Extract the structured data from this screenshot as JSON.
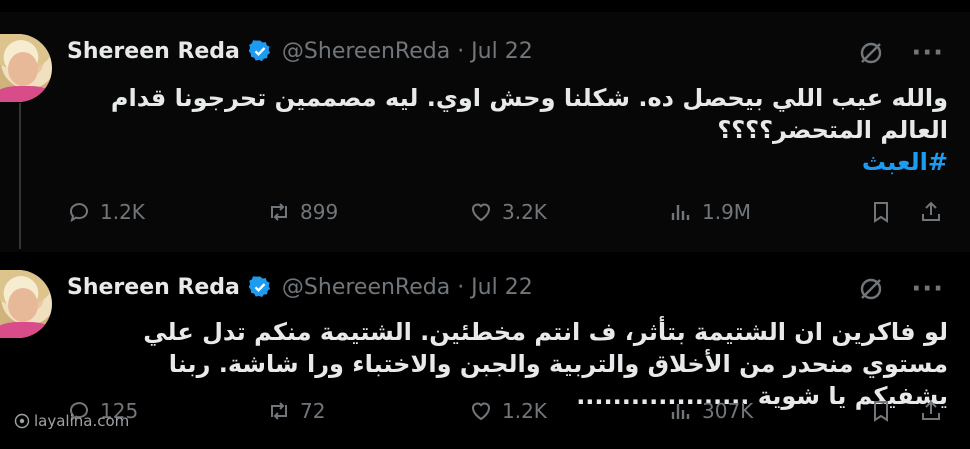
{
  "tweets": [
    {
      "name": "Shereen Reda",
      "handle": "@ShereenReda · Jul 22",
      "text": "والله عيب اللي بيحصل ده. شكلنا وحش اوي. ليه مصممين تحرجونا قدام العالم المتحضر؟؟؟؟",
      "hashtag": "#العبث",
      "replies": "1.2K",
      "reposts": "899",
      "likes": "3.2K",
      "views": "1.9M"
    },
    {
      "name": "Shereen Reda",
      "handle": "@ShereenReda · Jul 22",
      "text": "لو فاكرين ان الشتيمة بتأثر، ف انتم مخطئين. الشتيمة منكم تدل علي مستوي منحدر من الأخلاق والتربية والجبن والاختباء ورا شاشة. ربنا يشفيكم يا شوية ...................",
      "replies": "125",
      "reposts": "72",
      "likes": "1.2K",
      "views": "307K"
    }
  ],
  "more_label": "···",
  "watermark": "layalina.com",
  "colors": {
    "accent": "#1d9bf0",
    "muted": "#71767b",
    "text": "#e7e9ea"
  },
  "icons": [
    "verified-badge-icon",
    "grok-icon",
    "more-icon",
    "reply-icon",
    "repost-icon",
    "like-icon",
    "views-icon",
    "bookmark-icon",
    "share-icon"
  ]
}
